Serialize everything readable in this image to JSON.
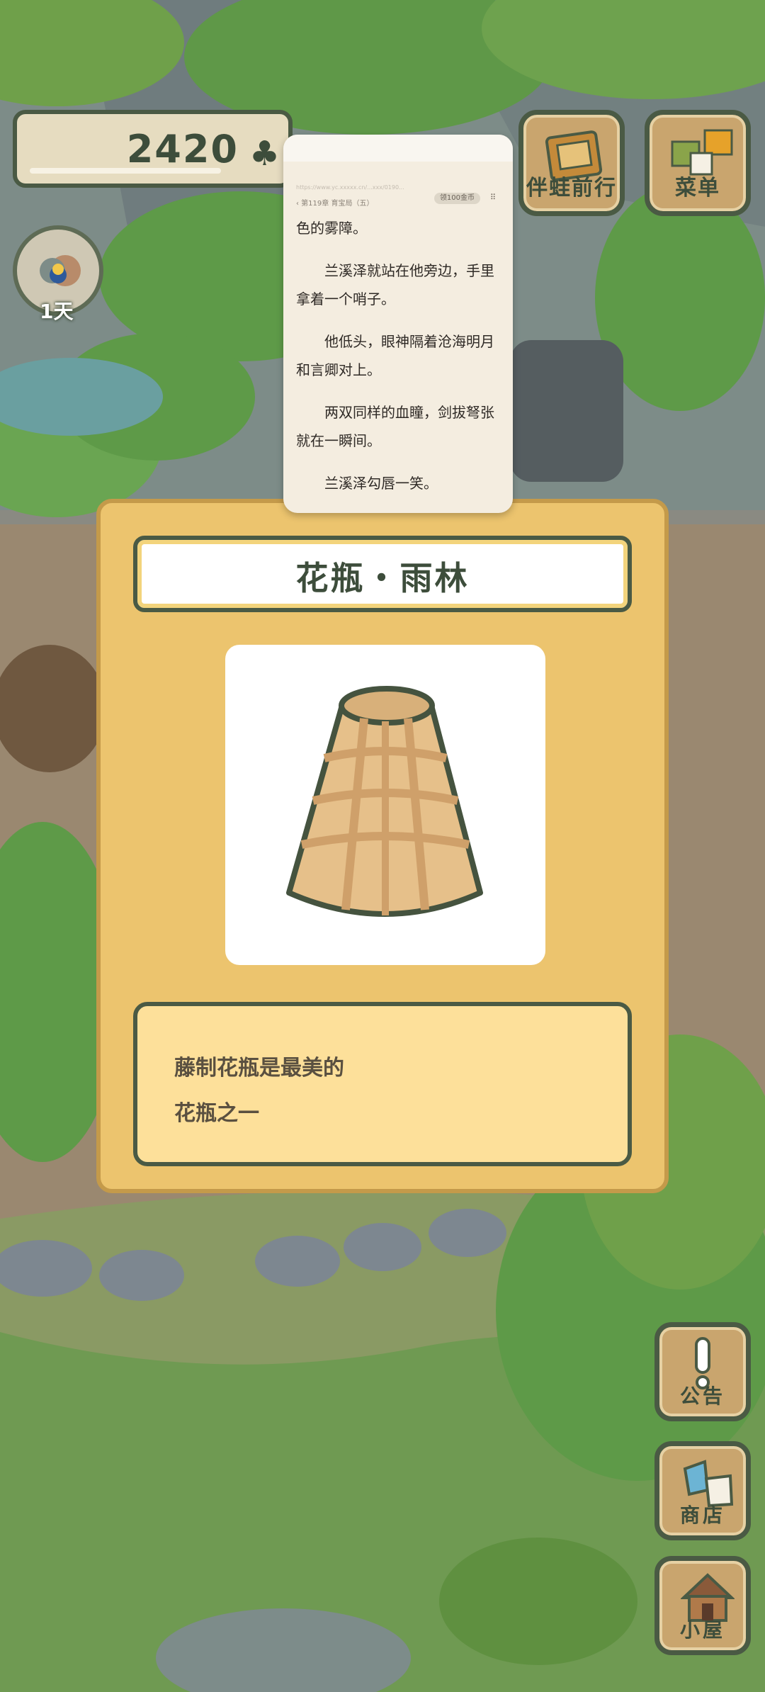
{
  "hud": {
    "clover_count": "2420",
    "day_label": "1天"
  },
  "buttons": {
    "companion": "伴蛙前行",
    "menu": "菜单",
    "notice": "公告",
    "shop": "商店",
    "house": "小屋"
  },
  "reader": {
    "url": "https://www.yc.xxxxx.cn/...xxx/0190...",
    "chapter": "‹ 第119章 育宝局（五）",
    "coin_pill": "领100金币",
    "menu_glyph": "⠿",
    "paragraphs": [
      "色的雾障。",
      "兰溪泽就站在他旁边，手里拿着一个哨子。",
      "他低头，眼神隔着沧海明月和言卿对上。",
      "两双同样的血瞳，剑拔弩张就在一瞬间。",
      "兰溪泽勾唇一笑。"
    ]
  },
  "item_card": {
    "title": "花瓶・雨林",
    "description_line1": "藤制花瓶是最美的",
    "description_line2": "花瓶之一"
  },
  "colors": {
    "card_bg": "#ecc46e",
    "outline": "#4a5a44",
    "desc_bg": "#fde09a"
  }
}
